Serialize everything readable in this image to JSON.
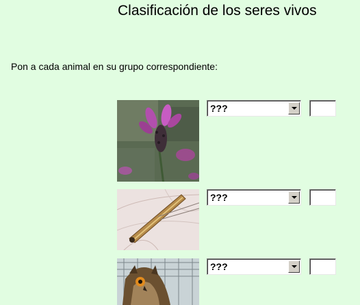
{
  "page": {
    "title": "Clasificación de los seres vivos",
    "instruction": "Pon a cada animal en su grupo correspondiente:"
  },
  "rows": [
    {
      "image_icon": "lavender-flower-photo",
      "select_value": "???",
      "answer_value": ""
    },
    {
      "image_icon": "larva-microscope-photo",
      "select_value": "???",
      "answer_value": ""
    },
    {
      "image_icon": "owl-photo",
      "select_value": "???",
      "answer_value": ""
    }
  ],
  "colors": {
    "page_background": "#e1fde1",
    "field_background": "#ffffff",
    "dropdown_button": "#d4d0c8"
  }
}
